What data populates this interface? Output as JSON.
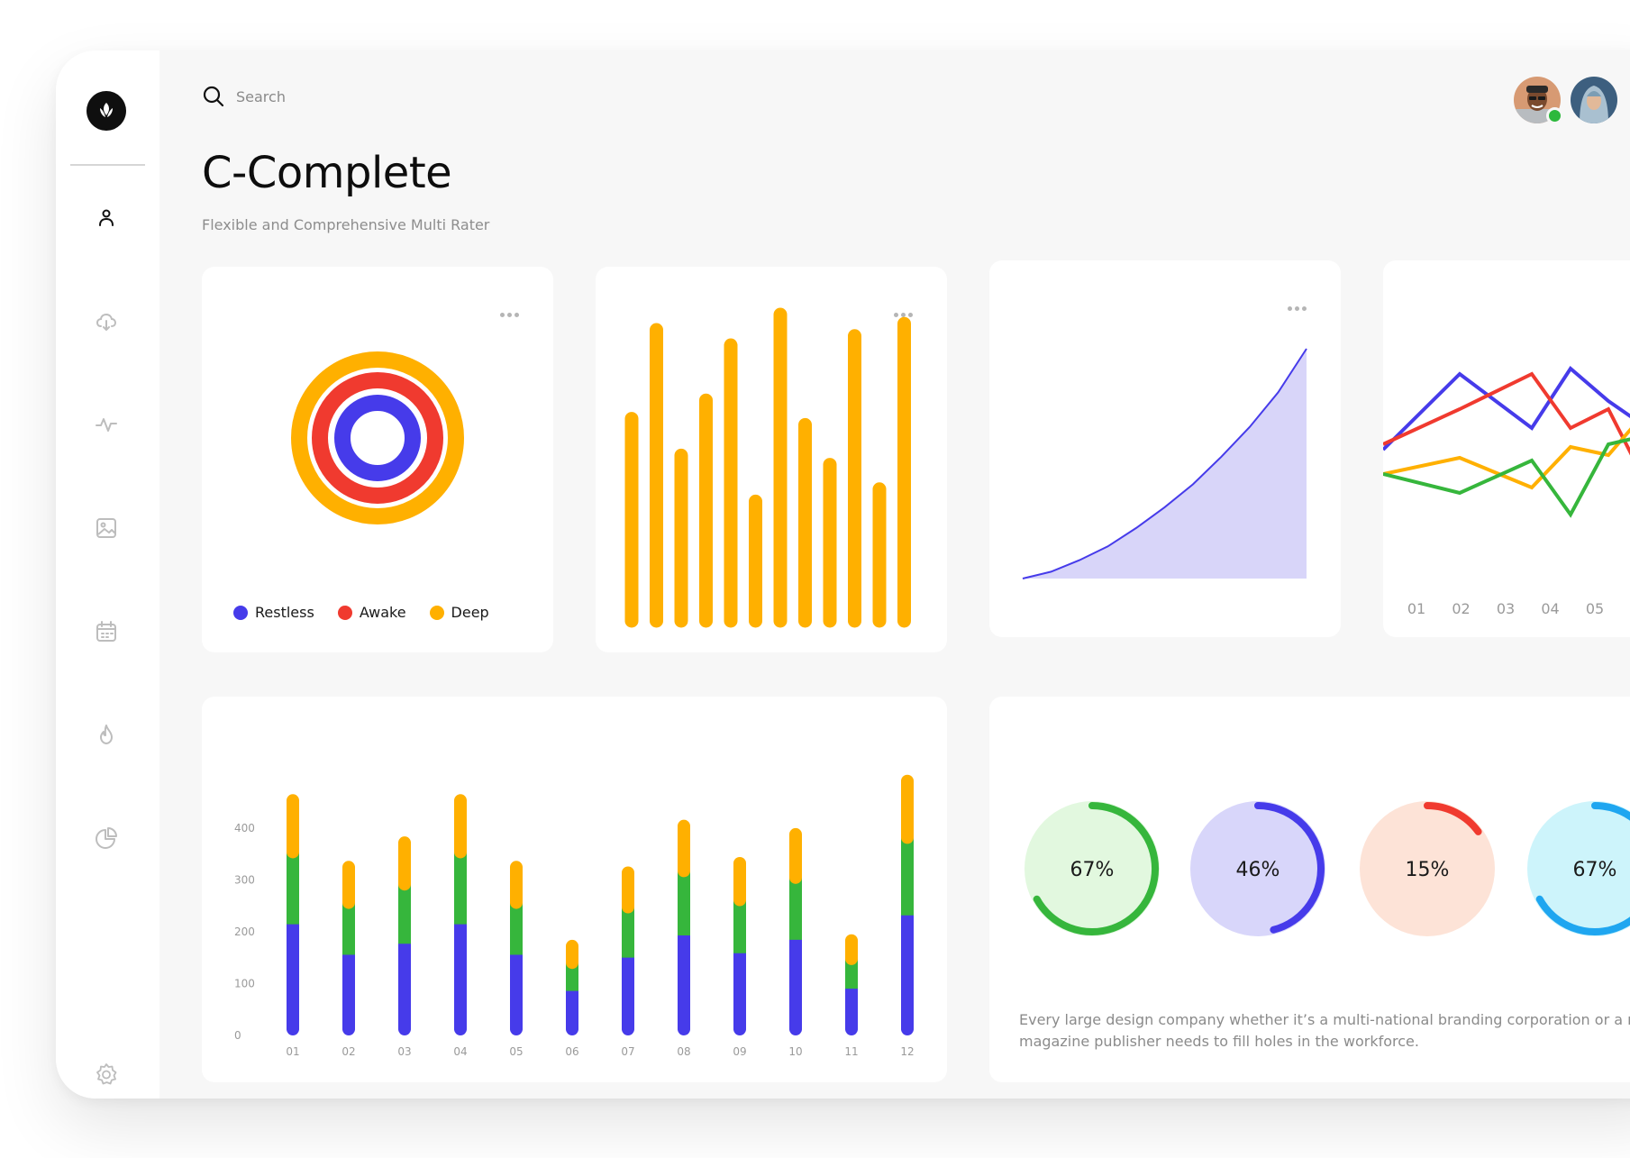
{
  "app": {
    "brand_icon": "leaf-logo-icon"
  },
  "sidebar": {
    "items": [
      {
        "name": "profile",
        "icon": "user-icon"
      },
      {
        "name": "download",
        "icon": "cloud-download-icon"
      },
      {
        "name": "activity",
        "icon": "activity-icon"
      },
      {
        "name": "gallery",
        "icon": "image-icon"
      },
      {
        "name": "calendar",
        "icon": "calendar-icon"
      },
      {
        "name": "trending",
        "icon": "flame-icon"
      },
      {
        "name": "reports",
        "icon": "pie-chart-icon"
      },
      {
        "name": "settings",
        "icon": "gear-icon"
      }
    ]
  },
  "search": {
    "placeholder": "Search"
  },
  "header": {
    "title": "C-Complete",
    "subtitle": "Flexible and Comprehensive Multi Rater"
  },
  "colors": {
    "restless": "#463bea",
    "awake": "#f03a2f",
    "deep": "#ffb000",
    "green": "#36b63c",
    "area_fill": "#d8d5f9"
  },
  "legend": [
    {
      "label": "Restless",
      "color": "#463bea"
    },
    {
      "label": "Awake",
      "color": "#f03a2f"
    },
    {
      "label": "Deep",
      "color": "#ffb000"
    }
  ],
  "chart_data": [
    {
      "type": "pie",
      "name": "concentric-rings",
      "series": [
        {
          "name": "Restless",
          "color": "#463bea"
        },
        {
          "name": "Awake",
          "color": "#f03a2f"
        },
        {
          "name": "Deep",
          "color": "#ffb000"
        }
      ]
    },
    {
      "type": "bar",
      "name": "yellow-bars",
      "values": [
        66,
        95,
        54,
        72,
        90,
        39,
        100,
        64,
        51,
        93,
        43,
        97
      ],
      "color": "#ffb000"
    },
    {
      "type": "area",
      "name": "growth-curve",
      "x": [
        0,
        1,
        2,
        3,
        4,
        5,
        6,
        7,
        8,
        9,
        10
      ],
      "values": [
        0,
        3,
        8,
        14,
        22,
        31,
        41,
        53,
        66,
        81,
        100
      ]
    },
    {
      "type": "line",
      "name": "multi-line",
      "categories": [
        "01",
        "02",
        "03",
        "04",
        "05"
      ],
      "series": [
        {
          "color": "#463bea",
          "values": [
            40,
            68,
            48,
            70,
            58,
            52
          ]
        },
        {
          "color": "#f03a2f",
          "values": [
            42,
            55,
            68,
            48,
            55,
            38
          ]
        },
        {
          "color": "#ffb000",
          "values": [
            31,
            37,
            26,
            41,
            38,
            48
          ]
        },
        {
          "color": "#36b63c",
          "values": [
            31,
            24,
            36,
            16,
            42,
            44
          ]
        }
      ]
    },
    {
      "type": "bar",
      "name": "stacked-bars",
      "categories": [
        "01",
        "02",
        "03",
        "04",
        "05",
        "06",
        "07",
        "08",
        "09",
        "10",
        "11",
        "12"
      ],
      "y_ticks": [
        "0",
        "100",
        "200",
        "300",
        "400"
      ],
      "ylim": [
        0,
        475
      ],
      "series": [
        {
          "color": "#463bea",
          "values": [
            200,
            145,
            165,
            200,
            145,
            80,
            140,
            180,
            148,
            172,
            84,
            216
          ]
        },
        {
          "color": "#36b63c",
          "values": [
            130,
            94,
            107,
            130,
            94,
            51,
            91,
            116,
            96,
            112,
            54,
            140
          ]
        },
        {
          "color": "#ffb000",
          "values": [
            104,
            75,
            86,
            104,
            75,
            41,
            73,
            92,
            77,
            89,
            44,
            113
          ]
        }
      ]
    },
    {
      "type": "pie",
      "name": "gauges",
      "series": [
        {
          "label": "67%",
          "value": 67,
          "color": "#36b63c",
          "bg": "#e2f8df"
        },
        {
          "label": "46%",
          "value": 46,
          "color": "#463bea",
          "bg": "#d8d6fa"
        },
        {
          "label": "15%",
          "value": 15,
          "color": "#f03a2f",
          "bg": "#fde3d7"
        },
        {
          "label": "67%",
          "value": 67,
          "color": "#1fa6f0",
          "bg": "#cdf4fb"
        }
      ]
    }
  ],
  "description": "Every large design company whether it’s a multi-national branding corporation or a regular down at heel tatty magazine publisher needs to fill holes in the workforce."
}
